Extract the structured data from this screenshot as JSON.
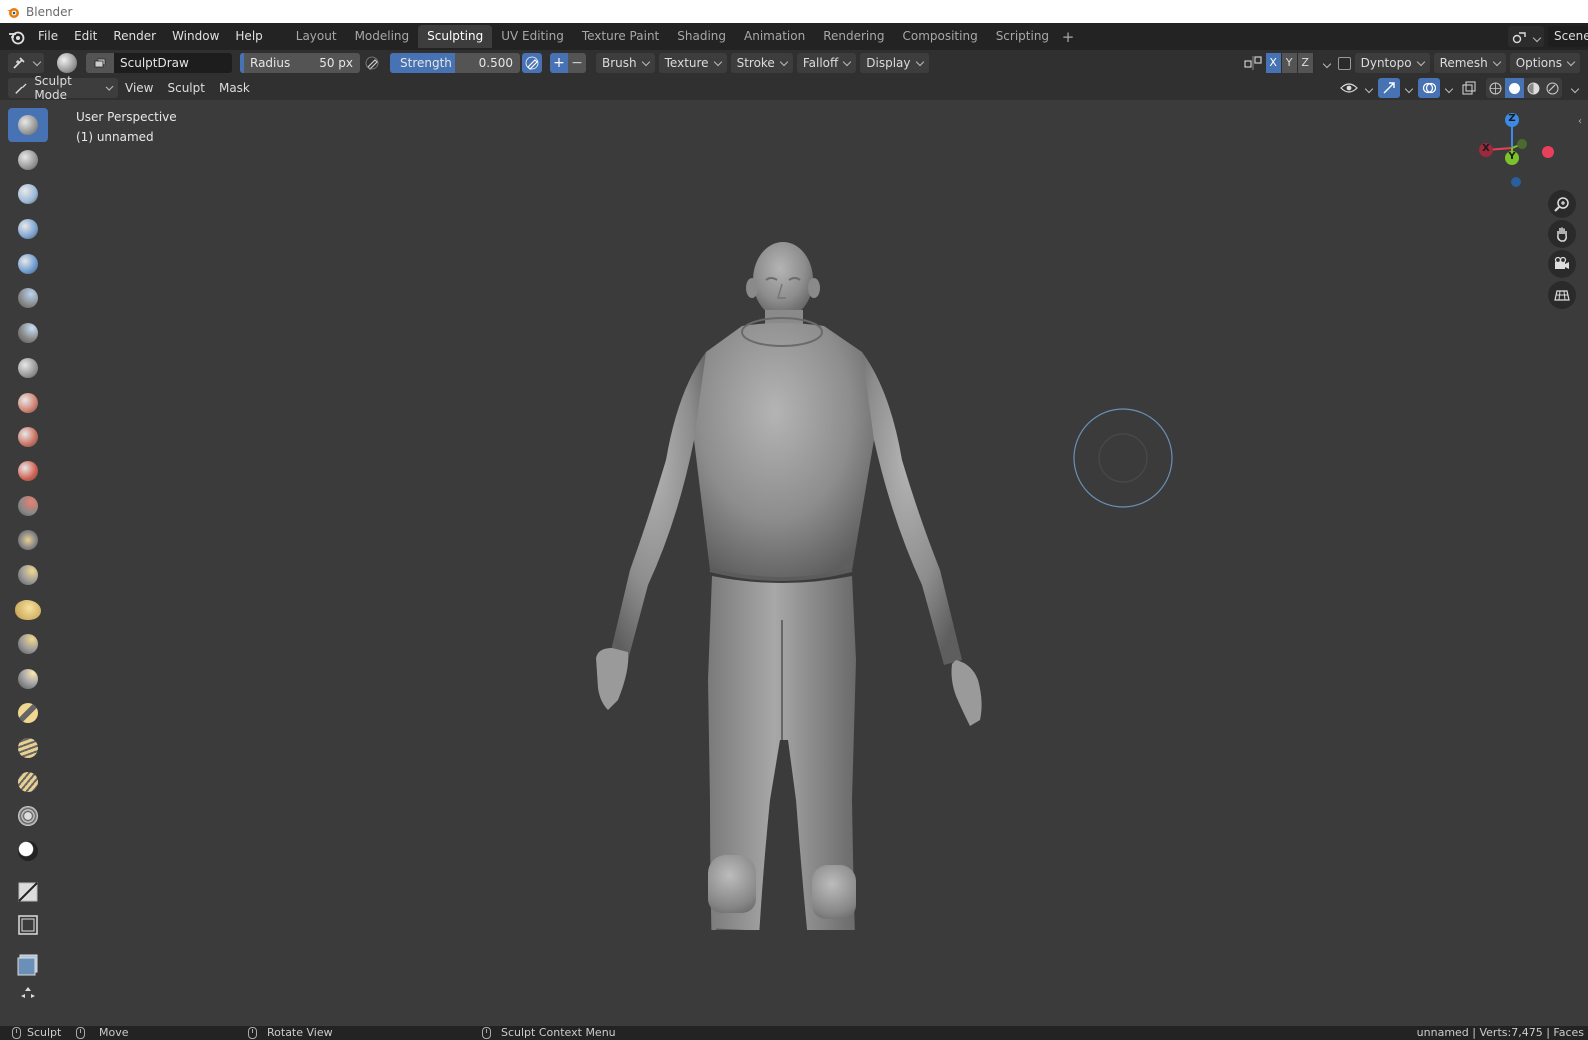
{
  "window": {
    "title": "Blender"
  },
  "menus": [
    "File",
    "Edit",
    "Render",
    "Window",
    "Help"
  ],
  "workspaces": {
    "tabs": [
      "Layout",
      "Modeling",
      "Sculpting",
      "UV Editing",
      "Texture Paint",
      "Shading",
      "Animation",
      "Rendering",
      "Compositing",
      "Scripting"
    ],
    "active": "Sculpting"
  },
  "scene": {
    "label": "Scene"
  },
  "tool_header": {
    "brush_name": "SculptDraw",
    "radius": {
      "label": "Radius",
      "value": "50 px"
    },
    "strength": {
      "label": "Strength",
      "value": "0.500",
      "fraction": 0.5
    },
    "menus": [
      "Brush",
      "Texture",
      "Stroke",
      "Falloff",
      "Display"
    ],
    "symmetry": [
      "X",
      "Y",
      "Z"
    ],
    "dyntopo": "Dyntopo",
    "remesh": "Remesh",
    "options": "Options"
  },
  "mode_row": {
    "mode": "Sculpt Mode",
    "menus": [
      "View",
      "Sculpt",
      "Mask"
    ]
  },
  "viewport": {
    "perspective": "User Perspective",
    "object": "(1) unnamed",
    "gizmo": {
      "x": "X",
      "y": "Y",
      "z": "Z"
    }
  },
  "tools": [
    "draw",
    "draw-sharp",
    "clay",
    "clay-strips",
    "layer",
    "inflate",
    "blob",
    "crease",
    "smooth",
    "flatten",
    "fill",
    "scrape",
    "pinch",
    "grab",
    "snake-hook",
    "thumb",
    "nudge",
    "rotate",
    "slide-relax",
    "simplify",
    "mask",
    "draw-face-sets",
    "box-mask",
    "box-hide",
    "mesh-filter",
    "move"
  ],
  "status_bar": {
    "left_click": "Sculpt",
    "middle_click": "Move",
    "rotate": "Rotate View",
    "context": "Sculpt Context Menu",
    "stats": "unnamed | Verts:7,475 | Faces"
  },
  "colors": {
    "accent": "#4772b3",
    "axis_x": "#e8405a",
    "axis_y": "#7cc32b",
    "axis_z": "#3b8ae6"
  }
}
